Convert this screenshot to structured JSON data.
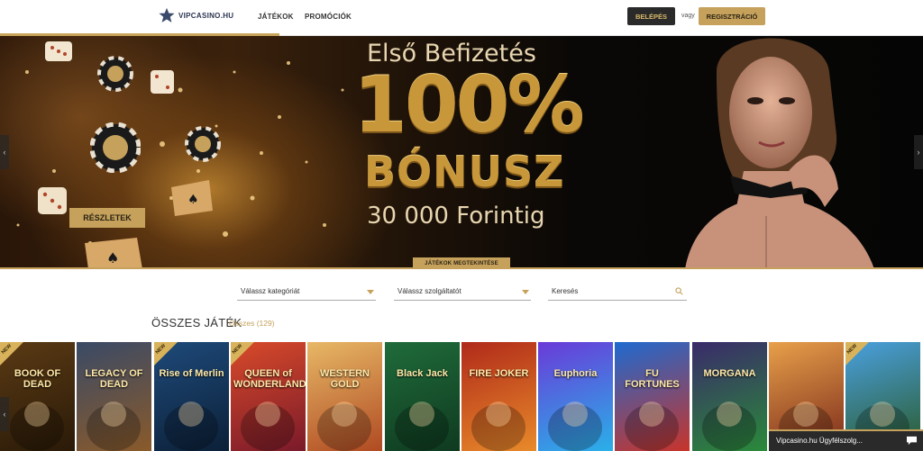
{
  "header": {
    "logo_text": "VIPCASINO.HU",
    "nav": [
      {
        "label": "JÁTÉKOK"
      },
      {
        "label": "PROMÓCIÓK"
      }
    ],
    "login_label": "BELÉPÉS",
    "or_text": "vagy",
    "register_label": "REGISZTRÁCIÓ"
  },
  "banner": {
    "line1": "Első Befizetés",
    "percent": "100%",
    "bonus": "BÓNUSZ",
    "amount": "30 000 Forintig",
    "details_label": "RÉSZLETEK",
    "games_tab_label": "JÁTÉKOK MEGTEKINTÉSE",
    "arrow_left": "‹",
    "arrow_right": "›"
  },
  "filters": {
    "category_placeholder": "Válassz kategóriát",
    "provider_placeholder": "Válassz szolgáltatót",
    "search_placeholder": "Keresés"
  },
  "games_section": {
    "title": "ÖSSZES JÁTÉK",
    "count_label": "Összes (129)",
    "new_badge": "NEW",
    "tiles": [
      {
        "name": "BOOK OF DEAD",
        "new": true,
        "bg": "#5a3a14",
        "bg2": "#2a1a08"
      },
      {
        "name": "LEGACY OF DEAD",
        "new": false,
        "bg": "#3a4a66",
        "bg2": "#8a5a2a"
      },
      {
        "name": "Rise of Merlin",
        "new": true,
        "bg": "#1e4a7a",
        "bg2": "#0c2038"
      },
      {
        "name": "QUEEN of WONDERLAND",
        "new": true,
        "bg": "#d84a2a",
        "bg2": "#7a1a2a"
      },
      {
        "name": "WESTERN GOLD",
        "new": false,
        "bg": "#e7b866",
        "bg2": "#b04a22"
      },
      {
        "name": "Black Jack",
        "new": false,
        "bg": "#1f6b3a",
        "bg2": "#0f3a20"
      },
      {
        "name": "FIRE JOKER",
        "new": false,
        "bg": "#b02a1a",
        "bg2": "#e88a2a"
      },
      {
        "name": "Euphoria",
        "new": false,
        "bg": "#6a3ad8",
        "bg2": "#2ab0e8"
      },
      {
        "name": "FU FORTUNES",
        "new": false,
        "bg": "#1e6ad0",
        "bg2": "#c8342a"
      },
      {
        "name": "MORGANA",
        "new": false,
        "bg": "#3a2a6a",
        "bg2": "#2a8a3a"
      },
      {
        "name": "",
        "new": false,
        "bg": "#e8a04a",
        "bg2": "#7a2a1a"
      },
      {
        "name": "",
        "new": true,
        "bg": "#4aa0e0",
        "bg2": "#2a5a2a"
      }
    ]
  },
  "chat": {
    "label": "Vipcasino.hu Ügyfélszolg..."
  },
  "colors": {
    "gold": "#c5a15b",
    "dark": "#2a2a2a"
  }
}
